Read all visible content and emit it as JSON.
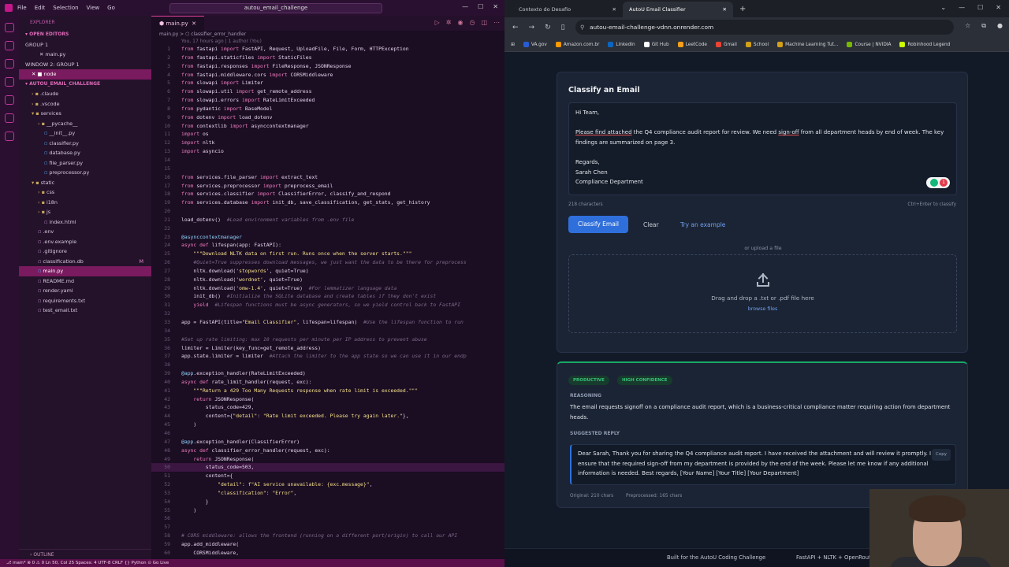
{
  "vscode": {
    "menu": [
      "File",
      "Edit",
      "Selection",
      "View",
      "Go"
    ],
    "search": "autou_email_challenge",
    "explorer_title": "EXPLORER",
    "open_editors": "OPEN EDITORS",
    "group1": "GROUP 1",
    "group1_file": "main.py",
    "window2": "WINDOW 2: GROUP 1",
    "node": "node",
    "project": "AUTOU_EMAIL_CHALLENGE",
    "tree": [
      {
        "label": ".claude",
        "indent": 2,
        "type": "folder"
      },
      {
        "label": ".vscode",
        "indent": 2,
        "type": "folder"
      },
      {
        "label": "services",
        "indent": 2,
        "type": "folder-open"
      },
      {
        "label": "__pycache__",
        "indent": 3,
        "type": "folder"
      },
      {
        "label": "__init__.py",
        "indent": 4,
        "type": "py"
      },
      {
        "label": "classifier.py",
        "indent": 4,
        "type": "py"
      },
      {
        "label": "database.py",
        "indent": 4,
        "type": "py"
      },
      {
        "label": "file_parser.py",
        "indent": 4,
        "type": "py"
      },
      {
        "label": "preprocessor.py",
        "indent": 4,
        "type": "py"
      },
      {
        "label": "static",
        "indent": 2,
        "type": "folder-open"
      },
      {
        "label": "css",
        "indent": 3,
        "type": "folder"
      },
      {
        "label": "i18n",
        "indent": 3,
        "type": "folder"
      },
      {
        "label": "js",
        "indent": 3,
        "type": "folder"
      },
      {
        "label": "index.html",
        "indent": 4,
        "type": "html"
      },
      {
        "label": ".env",
        "indent": 3,
        "type": "file"
      },
      {
        "label": ".env.example",
        "indent": 3,
        "type": "file"
      },
      {
        "label": ".gitignore",
        "indent": 3,
        "type": "file"
      },
      {
        "label": "classification.db",
        "indent": 3,
        "type": "db",
        "tag": "M"
      },
      {
        "label": "main.py",
        "indent": 3,
        "type": "py",
        "selected": true
      },
      {
        "label": "README.md",
        "indent": 3,
        "type": "md"
      },
      {
        "label": "render.yaml",
        "indent": 3,
        "type": "file"
      },
      {
        "label": "requirements.txt",
        "indent": 3,
        "type": "file"
      },
      {
        "label": "test_email.txt",
        "indent": 3,
        "type": "file"
      }
    ],
    "outline": "OUTLINE",
    "tab": "main.py",
    "breadcrumb": "main.py > ⬡ classifier_error_handler",
    "blame": "You, 17 hours ago | 1 author (You)",
    "status": "⎇ main*   ⊗ 0 ⚠ 0   Ln 50, Col 25   Spaces: 4   UTF-8   CRLF   {} Python   ⊙ Go Live",
    "code": [
      [
        1,
        "from fastapi import FastAPI, Request, UploadFile, File, Form, HTTPException"
      ],
      [
        2,
        "from fastapi.staticfiles import StaticFiles"
      ],
      [
        3,
        "from fastapi.responses import FileResponse, JSONResponse"
      ],
      [
        4,
        "from fastapi.middleware.cors import CORSMiddleware"
      ],
      [
        5,
        "from slowapi import Limiter"
      ],
      [
        6,
        "from slowapi.util import get_remote_address"
      ],
      [
        7,
        "from slowapi.errors import RateLimitExceeded"
      ],
      [
        8,
        "from pydantic import BaseModel"
      ],
      [
        9,
        "from dotenv import load_dotenv"
      ],
      [
        10,
        "from contextlib import asynccontextmanager"
      ],
      [
        11,
        "import os"
      ],
      [
        12,
        "import nltk"
      ],
      [
        13,
        "import asyncio"
      ],
      [
        14,
        ""
      ],
      [
        15,
        ""
      ],
      [
        16,
        "from services.file_parser import extract_text"
      ],
      [
        17,
        "from services.preprocessor import preprocess_email"
      ],
      [
        18,
        "from services.classifier import ClassifierError, classify_and_respond"
      ],
      [
        19,
        "from services.database import init_db, save_classification, get_stats, get_history"
      ],
      [
        20,
        ""
      ],
      [
        21,
        "load_dotenv()  #Load environment variables from .env file"
      ],
      [
        22,
        ""
      ],
      [
        23,
        "@asynccontextmanager"
      ],
      [
        24,
        "async def lifespan(app: FastAPI):"
      ],
      [
        25,
        "    \"\"\"Download NLTK data on first run. Runs once when the server starts.\"\"\""
      ],
      [
        26,
        "    #Quiet=True suppresses download messages, we just want the data to be there for preprocess"
      ],
      [
        27,
        "    nltk.download('stopwords', quiet=True)"
      ],
      [
        28,
        "    nltk.download('wordnet', quiet=True)"
      ],
      [
        29,
        "    nltk.download('omw-1.4', quiet=True)  #For lemmatizer language data"
      ],
      [
        30,
        "    init_db()  #Initialize the SQLite database and create tables if they don't exist"
      ],
      [
        31,
        "    yield  #Lifespan functions must be async generators, so we yield control back to FastAPI"
      ],
      [
        32,
        ""
      ],
      [
        33,
        "app = FastAPI(title=\"Email Classifier\", lifespan=lifespan)  #Use the lifespan function to run"
      ],
      [
        34,
        ""
      ],
      [
        35,
        "#Set up rate limiting: max 10 requests per minute per IP address to prevent abuse"
      ],
      [
        36,
        "limiter = Limiter(key_func=get_remote_address)"
      ],
      [
        37,
        "app.state.limiter = limiter  #Attach the limiter to the app state so we can use it in our endp"
      ],
      [
        38,
        ""
      ],
      [
        39,
        "@app.exception_handler(RateLimitExceeded)"
      ],
      [
        40,
        "async def rate_limit_handler(request, exc):"
      ],
      [
        41,
        "    \"\"\"Return a 429 Too Many Requests response when rate limit is exceeded.\"\"\""
      ],
      [
        42,
        "    return JSONResponse("
      ],
      [
        43,
        "        status_code=429,"
      ],
      [
        44,
        "        content={\"detail\": \"Rate limit exceeded. Please try again later.\"},"
      ],
      [
        45,
        "    )"
      ],
      [
        46,
        ""
      ],
      [
        47,
        "@app.exception_handler(ClassifierError)"
      ],
      [
        48,
        "async def classifier_error_handler(request, exc):"
      ],
      [
        49,
        "    return JSONResponse("
      ],
      [
        50,
        "        status_code=503,"
      ],
      [
        51,
        "        content={"
      ],
      [
        52,
        "            \"detail\": f\"AI service unavailable: {exc.message}\","
      ],
      [
        53,
        "            \"classification\": \"Error\","
      ],
      [
        54,
        "        }"
      ],
      [
        55,
        "    )"
      ],
      [
        56,
        ""
      ],
      [
        57,
        ""
      ],
      [
        58,
        "# CORS middleware: allows the frontend (running on a different port/origin) to call our API"
      ],
      [
        59,
        "app.add_middleware("
      ],
      [
        60,
        "    CORSMiddleware,"
      ]
    ]
  },
  "browser": {
    "tabs": [
      {
        "label": "Contexto do Desafio",
        "active": false
      },
      {
        "label": "AutoU Email Classifier",
        "active": true
      }
    ],
    "url": "autou-email-challenge-vdnn.onrender.com",
    "bookmarks": [
      "VA.gov",
      "Amazon.com.br",
      "LinkedIn",
      "Git Hub",
      "LeetCode",
      "Gmail",
      "School",
      "Machine Learning Tut...",
      "Course | NVIDIA",
      "Robinhood Legend"
    ],
    "bookmark_colors": [
      "#2a5bd7",
      "#ff9900",
      "#0a66c2",
      "#ffffff",
      "#f89f1b",
      "#ea4335",
      "#d4a017",
      "#d4a017",
      "#76b900",
      "#ccff00"
    ],
    "classify": {
      "title": "Classify an Email",
      "email_lines": [
        "Hi Team,",
        "",
        "__Please find attached__ the Q4 compliance audit report for review. We need __sign-off__ from all department heads by end of week. The key findings are summarized on page 3.",
        "",
        "Regards,",
        "Sarah Chen",
        "Compliance Department"
      ],
      "p_greeting": "Hi Team,",
      "p1_u1": "Please find attached",
      "p1_mid": " the Q4 compliance audit report for review. We need ",
      "p1_u2": "sign-off",
      "p1_end": " from all department heads by end of week. The key findings are summarized on page 3.",
      "regards": "Regards,",
      "name": "Sarah Chen",
      "dept": "Compliance Department",
      "grammarly_count": "1",
      "char_count": "218 characters",
      "shortcut": "Ctrl+Enter to classify",
      "btn_classify": "Classify Email",
      "btn_clear": "Clear",
      "btn_example": "Try an example",
      "or_upload": "or upload a file",
      "drop_text": "Drag and drop a .txt or .pdf file here",
      "browse": "browse files"
    },
    "result": {
      "badge1": "PRODUCTIVE",
      "badge2": "HIGH CONFIDENCE",
      "reasoning_label": "REASONING",
      "reasoning": "The email requests signoff on a compliance audit report, which is a business-critical compliance matter requiring action from department heads.",
      "reply_label": "SUGGESTED REPLY",
      "reply": "Dear Sarah, Thank you for sharing the Q4 compliance audit report. I have received the attachment and will review it promptly. I will ensure that the required sign-off from my department is provided by the end of the week. Please let me know if any additional information is needed. Best regards, [Your Name] [Your Title] [Your Department]",
      "copy": "Copy",
      "original": "Original: 210 chars",
      "processed": "Preprocessed: 165 chars"
    },
    "footer_left": "Built for the AutoU Coding Challenge",
    "footer_right": "FastAPI + NLTK + OpenRouter AI"
  }
}
